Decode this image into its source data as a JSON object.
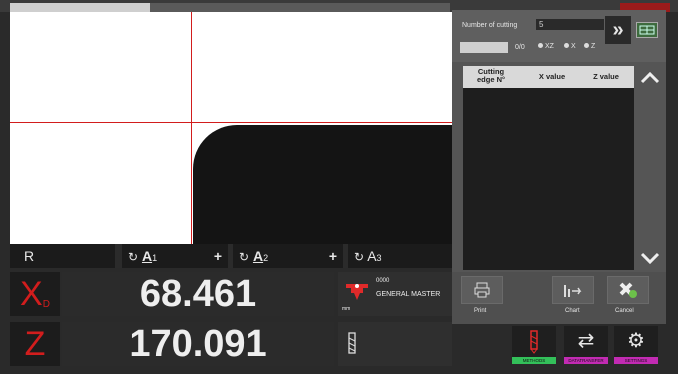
{
  "colors": {
    "accent_red": "#d21d1d",
    "methods_bar": "#33c05a",
    "datatransfer_bar": "#c22bb3",
    "settings_bar": "#c22bb3"
  },
  "status": {
    "mode": "R",
    "a1_label": "A",
    "a1_sub": "1",
    "a2_label": "A",
    "a2_sub": "2",
    "a3_label": "A",
    "a3_sub": "3",
    "plus": "+"
  },
  "axes": {
    "x_letter": "X",
    "x_sub": "D",
    "x_value": "68.461",
    "z_letter": "Z",
    "z_value": "170.091"
  },
  "tool": {
    "code": "0000",
    "name": "GENERAL MASTER",
    "unit": "mm"
  },
  "panel": {
    "number_of_cutting_label": "Number of cutting",
    "number_of_cutting_value": "5",
    "counter": "0/0",
    "radio_options": [
      "XZ",
      "X",
      "Z"
    ],
    "table_headers": [
      "Cutting edge N°",
      "X value",
      "Z value"
    ],
    "actions": [
      "Print",
      "Chart",
      "Cancel"
    ]
  },
  "nav": {
    "methods": "METHODS",
    "datatransfer": "DATATRANSFER",
    "settings": "SETTINGS"
  },
  "icons": {
    "fast_forward": "double-chevron-right-icon",
    "grid": "grid-icon",
    "scroll_up": "chevron-up-icon",
    "scroll_down": "chevron-down-icon",
    "print": "printer-icon",
    "chart": "chart-icon",
    "cancel": "cancel-icon",
    "methods": "drill-icon",
    "datatransfer": "transfer-arrows-icon",
    "settings": "gear-icon",
    "rotate": "rotate-icon"
  }
}
